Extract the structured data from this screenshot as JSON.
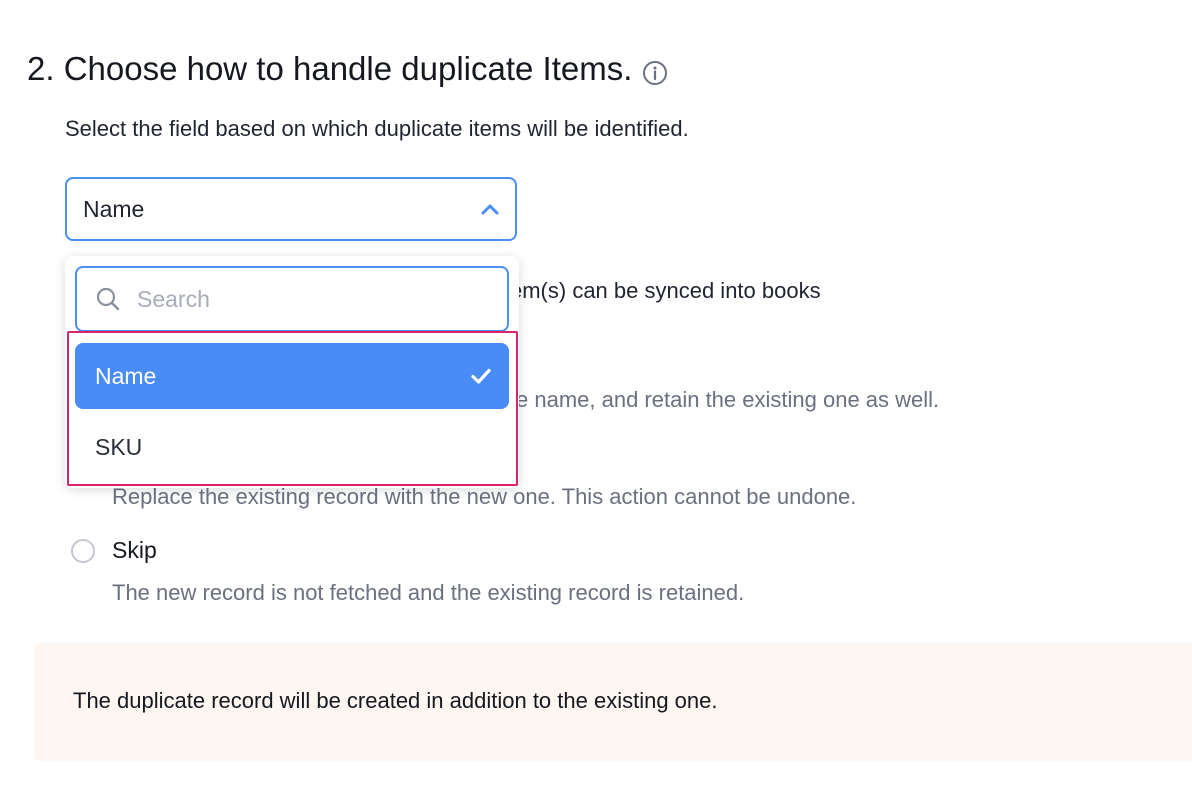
{
  "section": {
    "heading": "2. Choose how to handle duplicate Items.",
    "subtext": "Select the field based on which duplicate items will be identified."
  },
  "select": {
    "value": "Name",
    "expanded": true
  },
  "dropdown": {
    "search_placeholder": "Search",
    "options": [
      {
        "label": "Name",
        "selected": true
      },
      {
        "label": "SKU",
        "selected": false
      }
    ]
  },
  "background": {
    "sync_note_fragment": "em(s) can be synced into books",
    "retain_fragment": "e name, and retain the existing one as well.",
    "replace_desc": "Replace the existing record with the new one. This action cannot be undone."
  },
  "skip_option": {
    "label": "Skip",
    "description": "The new record is not fetched and the existing record is retained.",
    "selected": false
  },
  "notice": {
    "text": "The duplicate record will be created in addition to the existing one."
  },
  "colors": {
    "accent": "#4a8cf6",
    "border_focus": "#4a90f0",
    "highlight": "#d6246e",
    "muted_text": "#6b7080",
    "notice_bg": "#fef7f1"
  },
  "icons": {
    "heading_info": "info-icon",
    "select_toggle": "chevron-up-icon",
    "search": "search-icon",
    "selected_mark": "check-icon"
  }
}
